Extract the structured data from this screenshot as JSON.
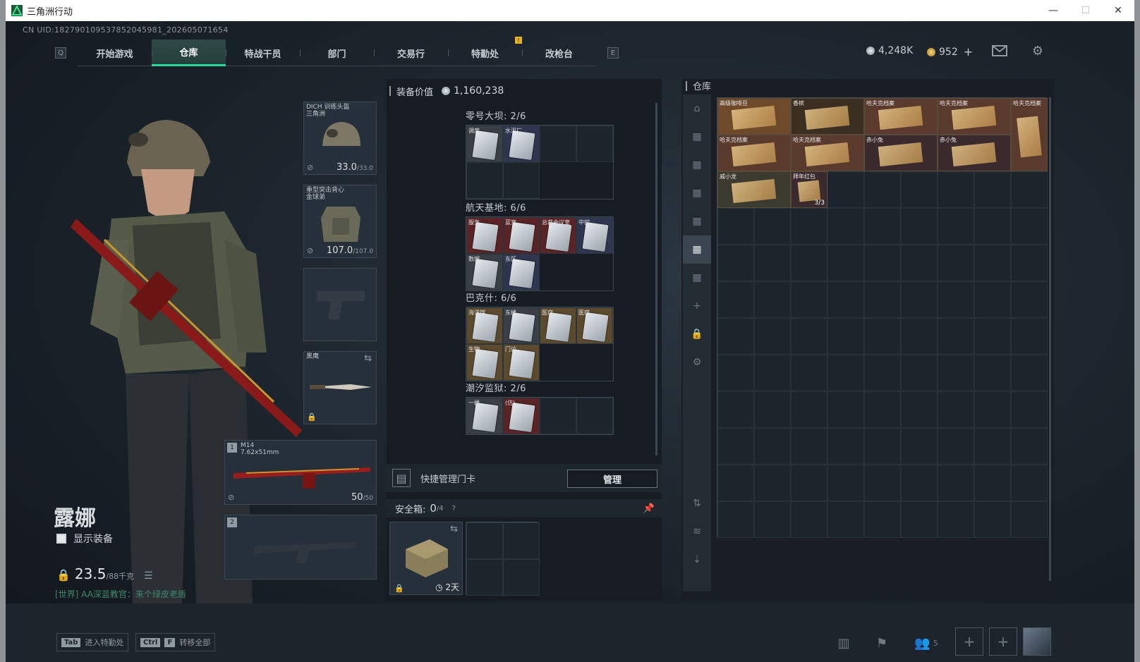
{
  "window": {
    "title": "三角洲行动",
    "min": "—",
    "max": "☐",
    "close": "✕"
  },
  "uid": "CN UID:182790109537852045981_202605071654",
  "nav": {
    "left_key": "Q",
    "right_key": "E",
    "tabs": [
      "开始游戏",
      "仓库",
      "特战干员",
      "部门",
      "交易行",
      "特勤处",
      "改枪台"
    ],
    "active": 1
  },
  "currency": {
    "silver": "4,248K",
    "gold": "952",
    "add": "+"
  },
  "accent": "#2fd69a",
  "character": {
    "name": "露娜",
    "show_equipment": "显示装备",
    "weight": "23.5",
    "weight_max": "/88千克",
    "chat": "[世界] AA深蓝教官：来个绿皮老盾"
  },
  "slots": {
    "helmet": {
      "label": "DICH 训练头盔",
      "sub": "三角洲",
      "dur": "33.0",
      "max": "/33.0"
    },
    "armor": {
      "label": "重型突击背心",
      "sub": "金球弟",
      "dur": "107.0",
      "max": "/107.0"
    },
    "knife": {
      "label": "黑鹰"
    },
    "primary": {
      "num": "1",
      "label": "M14",
      "sub": "7.62x51mm",
      "ammo": "50",
      "ammo_max": "/50"
    },
    "secondary": {
      "num": "2"
    }
  },
  "equip_value": {
    "label": "装备价值",
    "value": "1,160,238"
  },
  "key_zones": [
    {
      "title": "零号大坝: 2/6",
      "cells": [
        {
          "c": "grey",
          "l": "调度"
        },
        {
          "c": "blue",
          "l": "水泥厂"
        },
        {
          "c": ""
        },
        {
          "c": ""
        },
        {
          "c": ""
        },
        {
          "c": ""
        }
      ],
      "rows": 2,
      "shape": [
        1,
        1,
        1,
        1,
        1,
        1,
        0,
        0
      ]
    },
    {
      "title": "航天基地: 6/6",
      "cells": [
        {
          "c": "red",
          "l": "服务"
        },
        {
          "c": "red",
          "l": "蓝室"
        },
        {
          "c": "red",
          "l": "总裁会议室"
        },
        {
          "c": "blue",
          "l": "中控"
        },
        {
          "c": "grey",
          "l": "数据"
        },
        {
          "c": "blue",
          "l": "东区"
        }
      ]
    },
    {
      "title": "巴克什: 6/6",
      "cells": [
        {
          "c": "gold",
          "l": "海洋馆"
        },
        {
          "c": "grey",
          "l": "东楼"
        },
        {
          "c": "gold",
          "l": "医疗"
        },
        {
          "c": "gold",
          "l": "医疗"
        },
        {
          "c": "gold",
          "l": "生物"
        },
        {
          "c": "gold",
          "l": "门诊"
        }
      ]
    },
    {
      "title": "潮汐监狱: 2/6",
      "cells": [
        {
          "c": "grey",
          "l": "一楼"
        },
        {
          "c": "red",
          "l": "(仿)"
        },
        {
          "c": ""
        },
        {
          "c": ""
        }
      ]
    }
  ],
  "quick": {
    "label": "快捷管理门卡",
    "button": "管理"
  },
  "safe": {
    "label": "安全箱:",
    "value": "0",
    "max": "/4",
    "help": "?",
    "time": "2天"
  },
  "warehouse": {
    "title": "仓库",
    "items": [
      {
        "l": "高级咖啡豆",
        "color": "#6e4a2a",
        "w": 2,
        "h": 1,
        "cnt": ""
      },
      {
        "l": "香槟",
        "color": "#3a2e20",
        "w": 2,
        "h": 1,
        "cnt": ""
      },
      {
        "l": "哈夫克档案",
        "color": "#5a3a2c",
        "w": 2,
        "h": 1,
        "cnt": ""
      },
      {
        "l": "哈夫克档案",
        "color": "#5a3a2c",
        "w": 2,
        "h": 1,
        "cnt": ""
      },
      {
        "l": "哈夫克档案",
        "color": "#5a3a2c",
        "w": 1,
        "h": 2,
        "cnt": ""
      },
      {
        "l": "哈夫克档案",
        "color": "#5a3a2c",
        "w": 2,
        "h": 1,
        "cnt": ""
      },
      {
        "l": "哈夫克档案",
        "color": "#5a3a2c",
        "w": 2,
        "h": 1,
        "cnt": ""
      },
      {
        "l": "赤小兔",
        "color": "#3a2a2e",
        "w": 2,
        "h": 1,
        "cnt": ""
      },
      {
        "l": "赤小兔",
        "color": "#3a2a2e",
        "w": 2,
        "h": 1,
        "cnt": ""
      },
      {
        "l": "威小龙",
        "color": "#3a3a2e",
        "w": 2,
        "h": 1,
        "cnt": ""
      },
      {
        "l": "拜年红包",
        "color": "#3a2a2e",
        "w": 1,
        "h": 1,
        "cnt": "3/3"
      }
    ]
  },
  "bottom": {
    "hint1_key": "Tab",
    "hint1": "进入特勤处",
    "hint2_key1": "Ctrl",
    "hint2_key2": "F",
    "hint2": "转移全部",
    "friends": "5"
  }
}
